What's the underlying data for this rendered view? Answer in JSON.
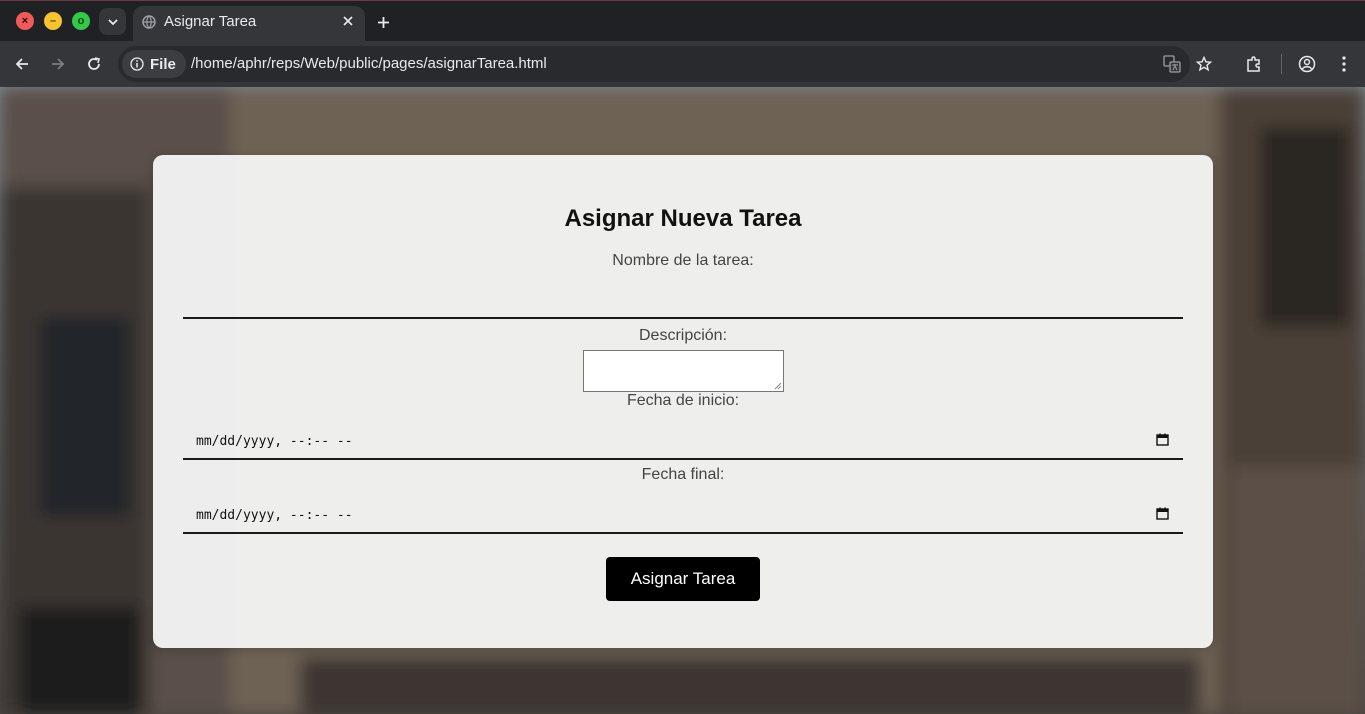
{
  "browser": {
    "tab": {
      "title": "Asignar Tarea"
    },
    "site_chip": "File",
    "url": "/home/aphr/reps/Web/public/pages/asignarTarea.html",
    "window_controls": {
      "close": "×",
      "minimize": "–",
      "maximize": "o"
    }
  },
  "form": {
    "title": "Asignar Nueva Tarea",
    "name_label": "Nombre de la tarea:",
    "name_value": "",
    "description_label": "Descripción:",
    "description_value": "",
    "start_label": "Fecha de inicio:",
    "start_value": "mm/dd/yyyy, --:-- --",
    "end_label": "Fecha final:",
    "end_value": "mm/dd/yyyy, --:-- --",
    "submit_label": "Asignar Tarea"
  },
  "icons": [
    "chevron-down-icon",
    "globe-icon",
    "close-icon",
    "plus-icon",
    "back-icon",
    "forward-icon",
    "reload-icon",
    "info-icon",
    "translate-icon",
    "star-icon",
    "extensions-icon",
    "profile-icon",
    "menu-icon",
    "calendar-icon"
  ],
  "colors": {
    "button_bg": "#000000",
    "button_text": "#ffffff",
    "card_bg": "#f4f4f4",
    "input_border": "#1a1a1a"
  }
}
